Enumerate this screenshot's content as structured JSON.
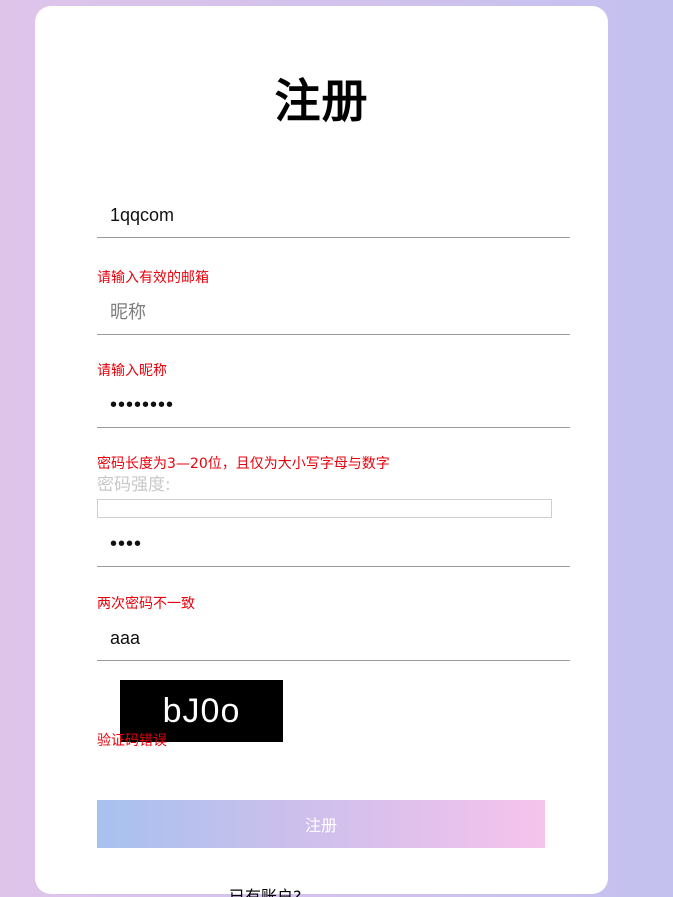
{
  "form": {
    "title": "注册",
    "email": {
      "value": "1qqcom",
      "error": "请输入有效的邮箱"
    },
    "nickname": {
      "value": "",
      "placeholder": "昵称",
      "error": "请输入昵称"
    },
    "password": {
      "value": "12345678",
      "error": "密码长度为3—20位，且仅为大小写字母与数字"
    },
    "strength": {
      "label": "密码强度:",
      "level": 0
    },
    "confirm_password": {
      "value": "1234",
      "error": "两次密码不一致"
    },
    "captcha_input": {
      "value": "aaa",
      "error": "验证码错误"
    },
    "captcha_code": "bJ0o",
    "submit_label": "注册",
    "bottom_link": "已有账户?"
  },
  "colors": {
    "error": "#e8000b",
    "captcha_bg": "#000000",
    "button_gradient": [
      "#a7c1ee",
      "#f6c3ec"
    ]
  }
}
